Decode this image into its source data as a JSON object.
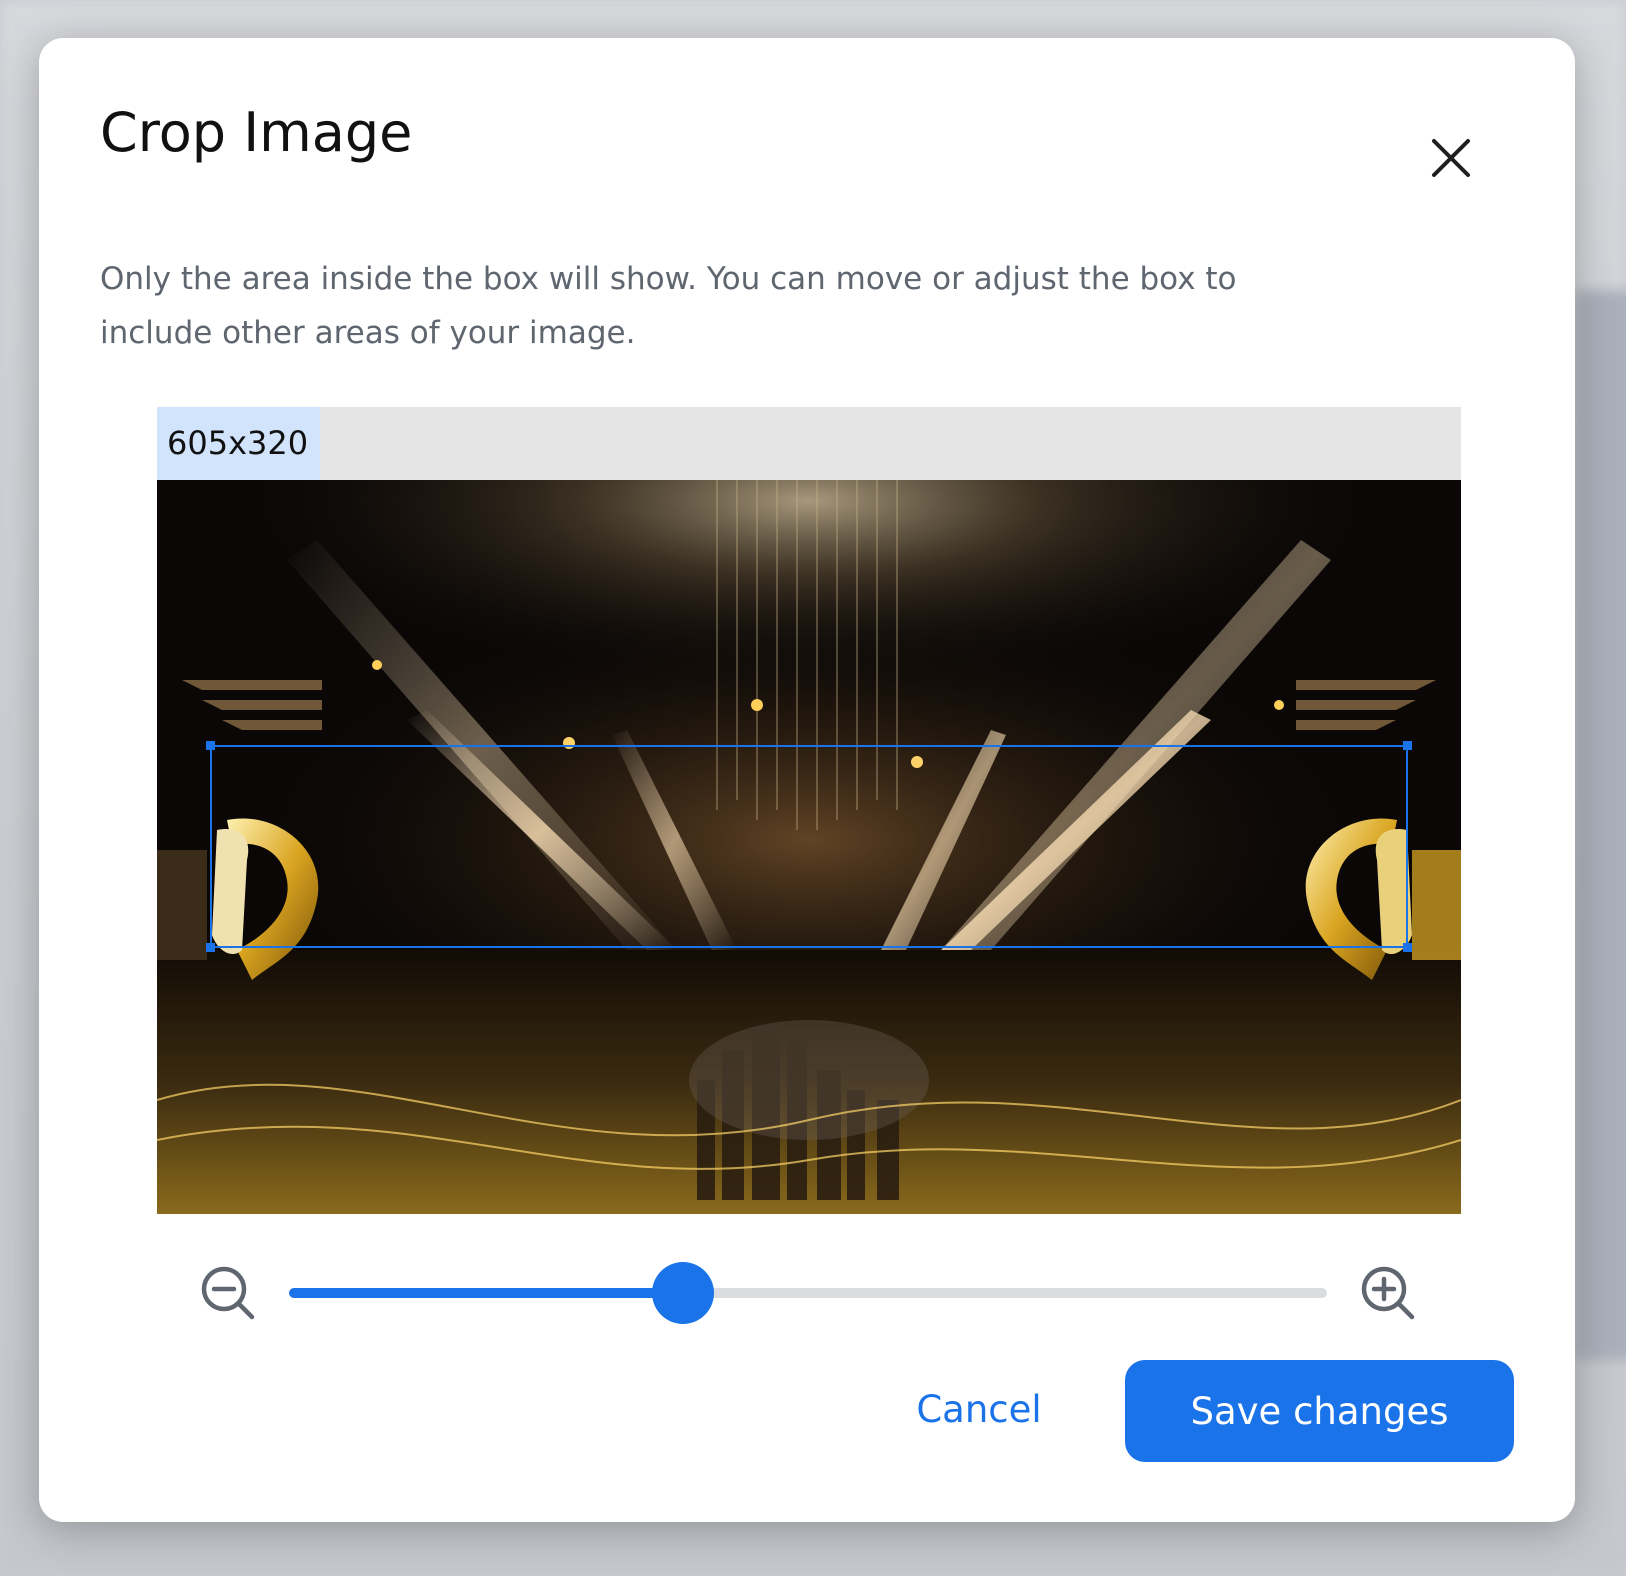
{
  "dialog": {
    "title": "Crop Image",
    "description": "Only the area inside the box will show. You can move or adjust the box to include other areas of your image.",
    "close_icon": "close-icon"
  },
  "crop": {
    "size_label": "605x320",
    "image_subject": "gold-trophy-stage-background"
  },
  "zoom": {
    "zoom_out_icon": "zoom-out-icon",
    "zoom_in_icon": "zoom-in-icon",
    "level_percent": 38
  },
  "actions": {
    "cancel_label": "Cancel",
    "save_label": "Save changes"
  },
  "colors": {
    "accent": "#1a73e8",
    "size_label_bg": "#d2e3fc"
  }
}
